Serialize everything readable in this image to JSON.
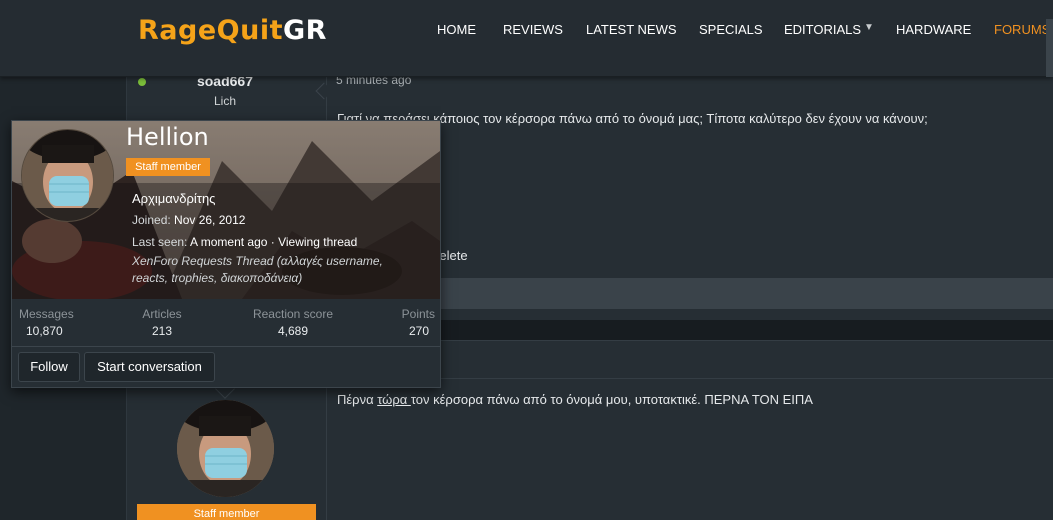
{
  "header": {
    "logo_main": "RageQuit",
    "logo_suffix": "GR",
    "nav": {
      "home": "HOME",
      "reviews": "REVIEWS",
      "latest_news": "LATEST NEWS",
      "specials": "SPECIALS",
      "editorials": "EDITORIALS",
      "hardware": "HARDWARE",
      "forums": "FORUMS"
    },
    "accent_color": "#f09121"
  },
  "post1": {
    "username": "soad667",
    "user_title": "Lich",
    "time": "5 minutes ago",
    "text": "Γιατί να περάσει κάποιος τον κέρσορα πάνω από το όνομά μας; Τίποτα καλύτερο δεν έχουν να κάνουν;",
    "delete_label": "Delete"
  },
  "post2": {
    "text_before": "Πέρνα ",
    "text_link": "τώρα ",
    "text_after": "τον κέρσορα πάνω από το όνομά μου, υποτακτικέ. ΠΕΡΝΑ ΤΟΝ ΕΙΠΑ",
    "staff_badge": "Staff member"
  },
  "tooltip": {
    "name": "Hellion",
    "staff_badge": "Staff member",
    "rank": "Αρχιμανδρίτης",
    "joined_label": "Joined: ",
    "joined_value": "Nov 26, 2012",
    "last_seen_label": "Last seen: ",
    "last_seen_value": "A moment ago · Viewing thread",
    "activity": "XenForo Requests Thread (αλλαγές username, reacts, trophies, διακοπoδάνεια)",
    "stats": {
      "messages_label": "Messages",
      "messages_value": "10,870",
      "articles_label": "Articles",
      "articles_value": "213",
      "reaction_label": "Reaction score",
      "reaction_value": "4,689",
      "points_label": "Points",
      "points_value": "270"
    },
    "follow_label": "Follow",
    "conversation_label": "Start conversation"
  }
}
